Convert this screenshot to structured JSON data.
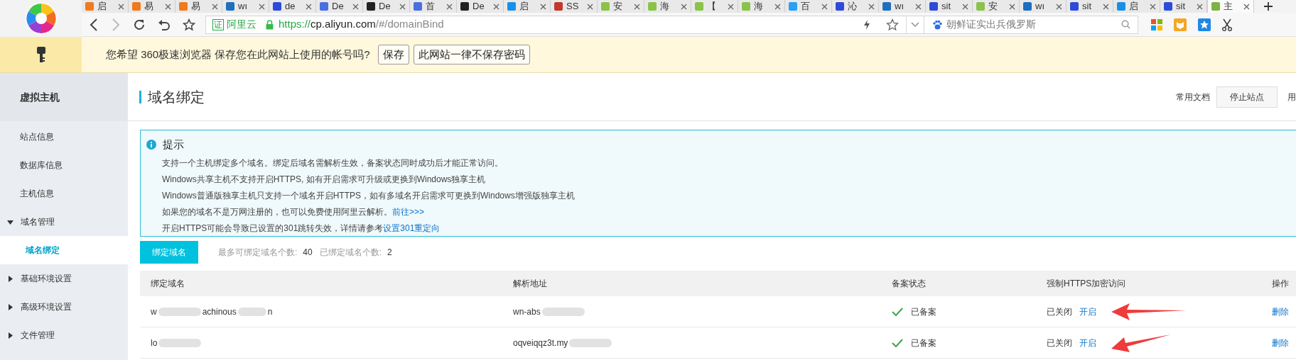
{
  "tabs": [
    {
      "title": "启",
      "color": "#f07a1c",
      "selected": false
    },
    {
      "title": "易",
      "color": "#f07a1c",
      "selected": false
    },
    {
      "title": "易",
      "color": "#f07a1c",
      "selected": false
    },
    {
      "title": "wı",
      "color": "#1f6fc0",
      "selected": false
    },
    {
      "title": "de",
      "color": "#2d4bd8",
      "selected": false
    },
    {
      "title": "De",
      "color": "#4a6fe0",
      "selected": false
    },
    {
      "title": "De",
      "color": "#222222",
      "selected": false
    },
    {
      "title": "首",
      "color": "#4a6fe0",
      "selected": false
    },
    {
      "title": "De",
      "color": "#222222",
      "selected": false
    },
    {
      "title": "启",
      "color": "#1a8fe8",
      "selected": false
    },
    {
      "title": "SS",
      "color": "#c0392b",
      "selected": false
    },
    {
      "title": "安",
      "color": "#8bc34a",
      "selected": false
    },
    {
      "title": "海",
      "color": "#8bc34a",
      "selected": false
    },
    {
      "title": "【",
      "color": "#8bc34a",
      "selected": false
    },
    {
      "title": "海",
      "color": "#8bc34a",
      "selected": false
    },
    {
      "title": "百",
      "color": "#2a9ff5",
      "selected": false
    },
    {
      "title": "沁",
      "color": "#2d4bd8",
      "selected": false
    },
    {
      "title": "wı",
      "color": "#1f6fc0",
      "selected": false
    },
    {
      "title": "sit",
      "color": "#2d4bd8",
      "selected": false
    },
    {
      "title": "安",
      "color": "#8bc34a",
      "selected": false
    },
    {
      "title": "wı",
      "color": "#1f6fc0",
      "selected": false
    },
    {
      "title": "sit",
      "color": "#2d4bd8",
      "selected": false
    },
    {
      "title": "启",
      "color": "#1a8fe8",
      "selected": false
    },
    {
      "title": "sit",
      "color": "#2d4bd8",
      "selected": false
    },
    {
      "title": "主",
      "color": "#7cb342",
      "selected": true
    }
  ],
  "address_bar": {
    "cert_badge": "证",
    "cert_name": "阿里云",
    "url_scheme": "https://",
    "url_host": "cp.aliyun.com",
    "url_path": "/#/domainBind",
    "forward_disabled": true
  },
  "search": {
    "placeholder": "朝鲜证实出兵俄罗斯"
  },
  "password_bar": {
    "message": "您希望 360极速浏览器 保存您在此网站上使用的帐号吗?",
    "buttons": [
      "保存",
      "此网站一律不保存密码"
    ]
  },
  "sidebar": {
    "title": "虚拟主机",
    "items": [
      {
        "label": "站点信息",
        "selected": false
      },
      {
        "label": "数据库信息",
        "selected": false
      },
      {
        "label": "主机信息",
        "selected": false
      },
      {
        "label": "域名管理",
        "selected": false,
        "expanded": true,
        "children": [
          {
            "label": "域名绑定",
            "selected": true
          }
        ]
      },
      {
        "label": "基础环境设置",
        "selected": false,
        "expanded": false
      },
      {
        "label": "高级环境设置",
        "selected": false,
        "expanded": false
      },
      {
        "label": "文件管理",
        "selected": false,
        "expanded": false
      }
    ]
  },
  "page": {
    "title": "域名绑定",
    "header_link": "常用文档",
    "header_button": "停止站点",
    "header_cut": "用"
  },
  "notice": {
    "title": "提示",
    "lines": [
      {
        "text": "支持一个主机绑定多个域名。绑定后域名需解析生效，备案状态同时成功后才能正常访问。"
      },
      {
        "text": "Windows共享主机不支持开启HTTPS, 如有开启需求可升级或更换到Windows独享主机"
      },
      {
        "text": "Windows普通版独享主机只支持一个域名开启HTTPS，如有多域名开启需求可更换到Windows增强版独享主机"
      },
      {
        "text": "如果您的域名不是万网注册的，也可以免费使用阿里云解析。",
        "link": "前往>>>"
      },
      {
        "text": "开启HTTPS可能会导致已设置的301跳转失效，详情请参考",
        "link": "设置301重定向"
      }
    ]
  },
  "bind_button": "绑定域名",
  "counts": {
    "max_label": "最多可绑定域名个数:",
    "max_value": "40",
    "bound_label": "已绑定域名个数:",
    "bound_value": "2"
  },
  "table": {
    "columns": [
      "绑定域名",
      "解析地址",
      "备案状态",
      "强制HTTPS加密访问",
      "操作"
    ],
    "rows": [
      {
        "domain": [
          "w",
          "achinous",
          "n"
        ],
        "address": [
          "wn-abs"
        ],
        "filing": "已备案",
        "https_state": "已关闭",
        "https_action": "开启",
        "action": "删除",
        "arrow": true
      },
      {
        "domain": [
          "lo"
        ],
        "address": [
          "oqveiqqz3t.my"
        ],
        "filing": "已备案",
        "https_state": "已关闭",
        "https_action": "开启",
        "action": "删除",
        "arrow": true
      }
    ]
  }
}
